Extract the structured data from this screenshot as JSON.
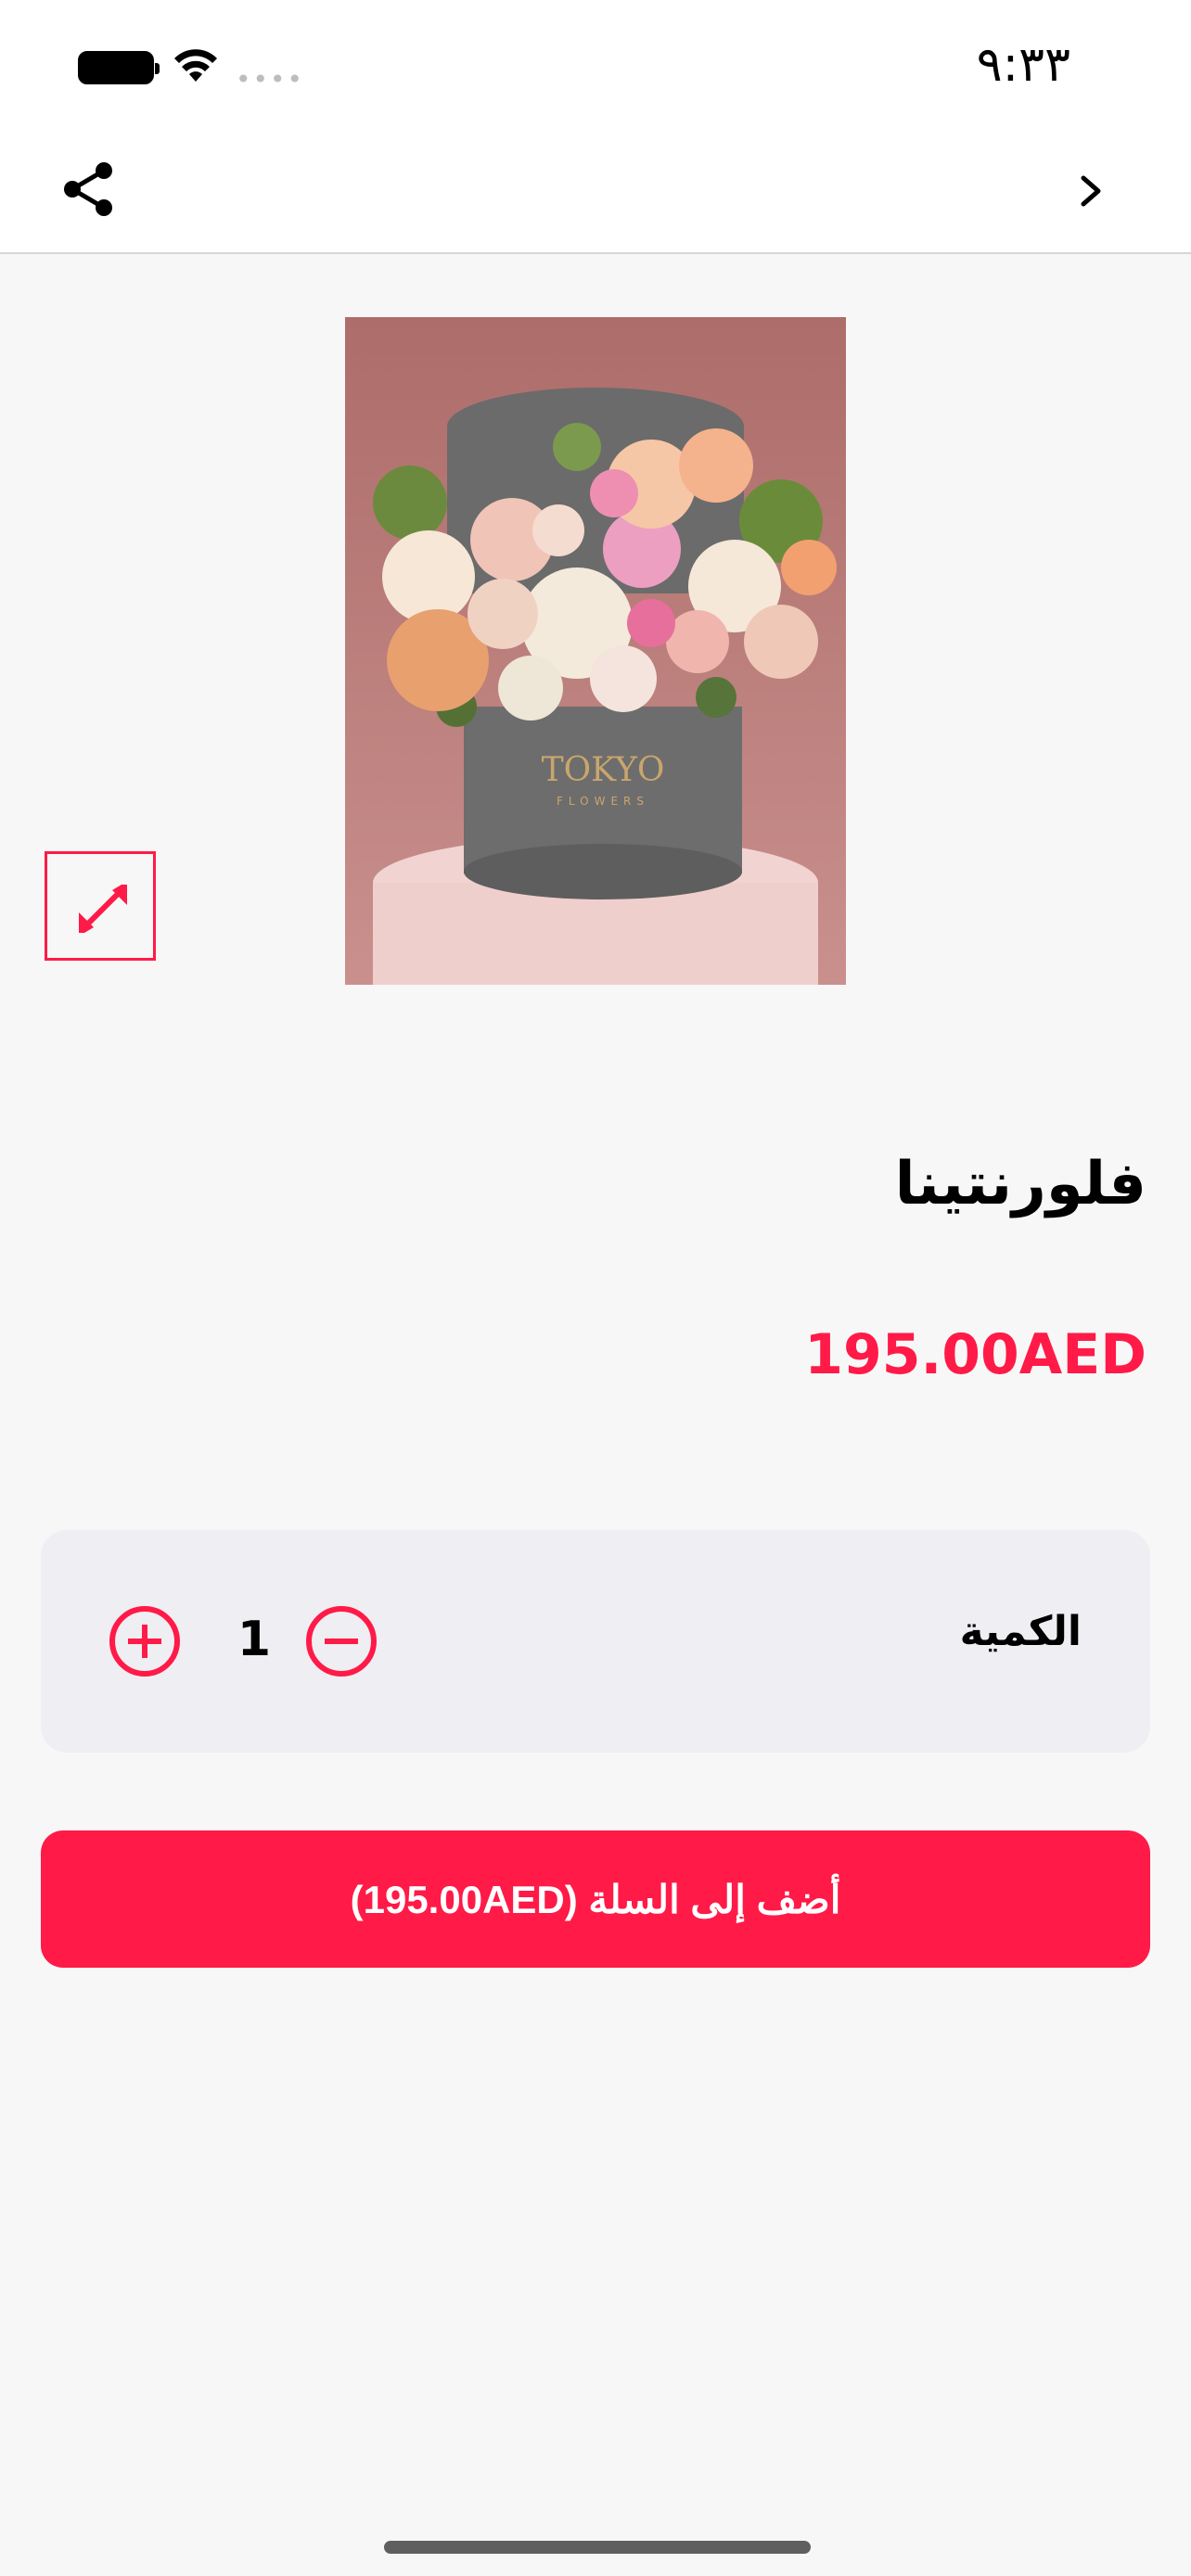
{
  "status_bar": {
    "time": "٩:٣٣",
    "signal_dots": "••••"
  },
  "nav": {
    "share_icon": "share-icon",
    "back_icon": "chevron-right-icon"
  },
  "product": {
    "image_icon": "flower-bouquet-photo",
    "image_brand_text": "TOKYO",
    "image_brand_subtext": "FLOWERS",
    "title": "فلورنتينا",
    "price": "195.00AED"
  },
  "quantity": {
    "label": "الكمية",
    "value": "1"
  },
  "cart_button": {
    "label": "أضف إلى السلة (195.00AED)"
  },
  "colors": {
    "accent": "#ff1a47",
    "background": "#f7f7f7",
    "card": "#efeef3"
  }
}
